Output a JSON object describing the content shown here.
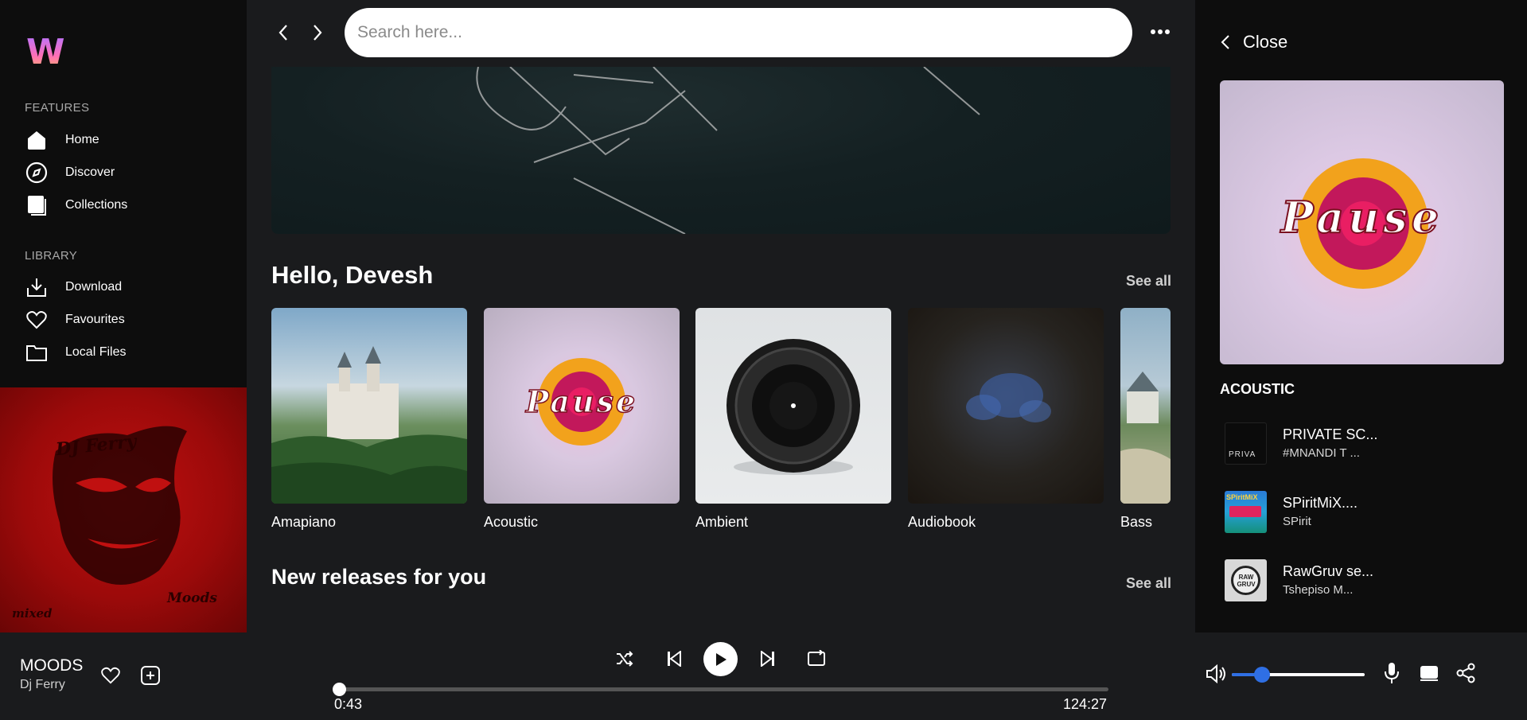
{
  "app": {
    "logo_letter": "W"
  },
  "sidebar": {
    "features_label": "FEATURES",
    "library_label": "LIBRARY",
    "features": [
      {
        "label": "Home",
        "icon": "home-icon"
      },
      {
        "label": "Discover",
        "icon": "compass-icon"
      },
      {
        "label": "Collections",
        "icon": "collections-icon"
      }
    ],
    "library": [
      {
        "label": "Download",
        "icon": "download-icon"
      },
      {
        "label": "Favourites",
        "icon": "heart-icon"
      },
      {
        "label": "Local Files",
        "icon": "folder-icon"
      }
    ],
    "album_art": {
      "line1": "DJ Ferry",
      "line2": "Moods",
      "line3": "mixed"
    }
  },
  "search": {
    "placeholder": "Search here...",
    "value": ""
  },
  "main": {
    "greeting": "Hello, Devesh",
    "greeting_see_all": "See all",
    "genres": [
      "Amapiano",
      "Acoustic",
      "Ambient",
      "Audiobook",
      "Bass"
    ],
    "new_releases_title": "New releases for you",
    "new_releases_see_all": "See all",
    "pause_art_text": "Pause"
  },
  "right_panel": {
    "close_label": "Close",
    "art_text": "Pause",
    "genre_title": "ACOUSTIC",
    "queue": [
      {
        "title": "PRIVATE SC...",
        "artist": "#MNANDI T ...",
        "thumb_text": "PRIVA"
      },
      {
        "title": "SPiritMiX....",
        "artist": "SPirit",
        "thumb_text": "SPiritMiX"
      },
      {
        "title": "RawGruv se...",
        "artist": "Tshepiso M...",
        "thumb_text": "RAW GRUV"
      }
    ]
  },
  "player": {
    "title": "MOODS",
    "artist": "Dj Ferry",
    "elapsed": "0:43",
    "duration": "124:27",
    "progress_fraction": 0.0059,
    "volume_fraction": 0.23,
    "accent_color": "#2f6fe4"
  }
}
